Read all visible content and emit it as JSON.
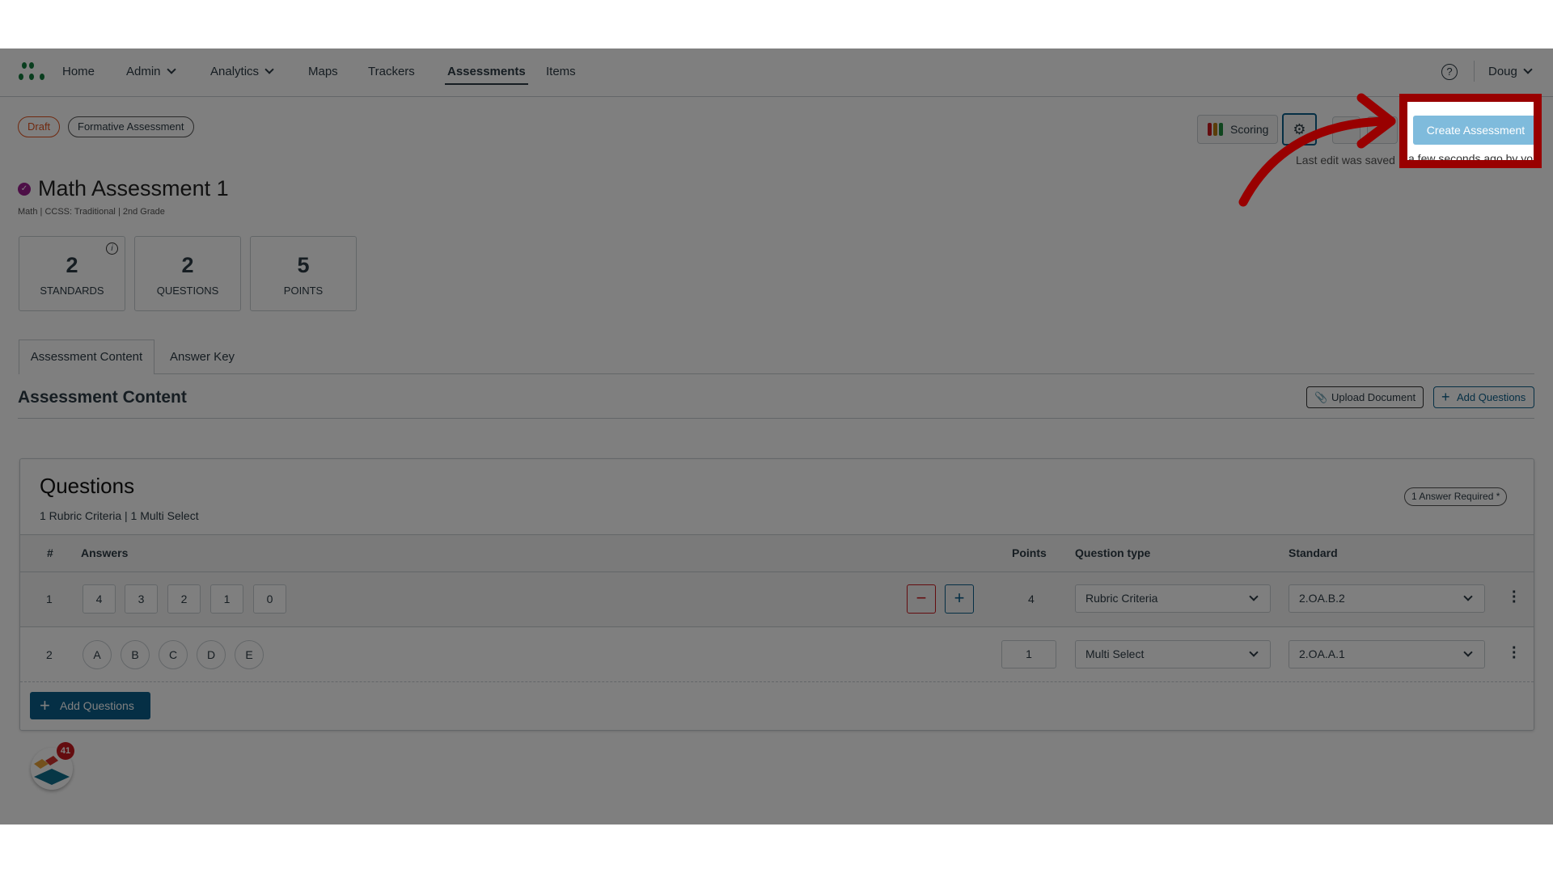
{
  "nav": {
    "items": [
      {
        "label": "Home"
      },
      {
        "label": "Admin",
        "dropdown": true
      },
      {
        "label": "Analytics",
        "dropdown": true
      },
      {
        "label": "Maps"
      },
      {
        "label": "Trackers"
      },
      {
        "label": "Assessments",
        "active": true
      },
      {
        "label": "Items"
      }
    ],
    "user": "Doug",
    "help_icon": "question-circle-icon"
  },
  "badges": {
    "status": "Draft",
    "type": "Formative Assessment"
  },
  "toolbar": {
    "scoring": "Scoring",
    "create": "Create Assessment",
    "saved_prefix": "Last edit was saved",
    "saved_suffix": "a few seconds ago by you"
  },
  "assessment": {
    "title": "Math Assessment 1",
    "subject": "Math",
    "framework": "CCSS: Traditional",
    "grade": "2nd Grade"
  },
  "stats": [
    {
      "value": "2",
      "label": "STANDARDS"
    },
    {
      "value": "2",
      "label": "QUESTIONS"
    },
    {
      "value": "5",
      "label": "POINTS"
    }
  ],
  "tabs": [
    {
      "label": "Assessment Content",
      "active": true
    },
    {
      "label": "Answer Key"
    }
  ],
  "content": {
    "heading": "Assessment Content",
    "upload": "Upload Document",
    "add": "Add Questions"
  },
  "questions": {
    "title": "Questions",
    "summary": "1 Rubric Criteria | 1 Multi Select",
    "required": "1 Answer Required *",
    "columns": {
      "num": "#",
      "answers": "Answers",
      "points": "Points",
      "type": "Question type",
      "standard": "Standard"
    },
    "rows": [
      {
        "num": "1",
        "answers": [
          "4",
          "3",
          "2",
          "1",
          "0"
        ],
        "points": "4",
        "type": "Rubric Criteria",
        "standard": "2.OA.B.2"
      },
      {
        "num": "2",
        "answers": [
          "A",
          "B",
          "C",
          "D",
          "E"
        ],
        "points": "1",
        "type": "Multi Select",
        "standard": "2.OA.A.1"
      }
    ],
    "add": "Add Questions"
  },
  "widget": {
    "badge": "41"
  },
  "colors": {
    "highlight": "#990000",
    "primary": "#0b5f8a",
    "create": "#7fbbdc",
    "draft": "#e0531f",
    "brand": "#127a3c"
  }
}
